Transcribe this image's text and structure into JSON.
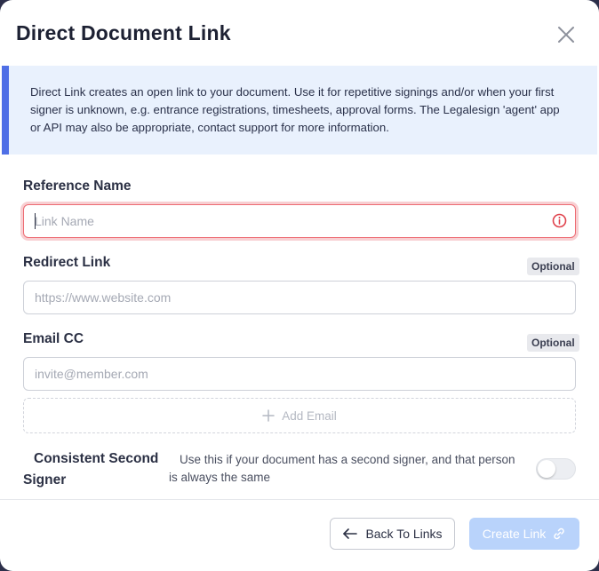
{
  "modal": {
    "title": "Direct Document Link",
    "close_icon": "close-icon"
  },
  "banner": {
    "text": "Direct Link creates an open link to your document. Use it for repetitive signings and/or when your first signer is unknown, e.g. entrance registrations, timesheets, approval forms. The Legalesign 'agent' app or API may also be appropriate, contact support for more information.",
    "accent_color": "#4f6fe6",
    "background_color": "#e9f1fd"
  },
  "form": {
    "reference_name": {
      "label": "Reference Name",
      "placeholder": "Link Name",
      "value": "",
      "state": "error",
      "status_icon": "info-error-icon"
    },
    "redirect_link": {
      "label": "Redirect Link",
      "optional_label": "Optional",
      "placeholder": "https://www.website.com",
      "value": ""
    },
    "email_cc": {
      "label": "Email CC",
      "optional_label": "Optional",
      "placeholder": "invite@member.com",
      "value": "",
      "add_button_label": "Add Email",
      "add_icon": "plus-icon"
    },
    "consistent_second_signer": {
      "label_line1": "Consistent Second",
      "label_line2": "Signer",
      "description_line1": "Use this if your document has a second signer, and that person",
      "description_line2": "is always the same",
      "enabled": false
    }
  },
  "footer": {
    "back_label": "Back To Links",
    "back_icon": "arrow-left-icon",
    "create_label": "Create Link",
    "create_icon": "link-icon",
    "create_enabled": false
  }
}
